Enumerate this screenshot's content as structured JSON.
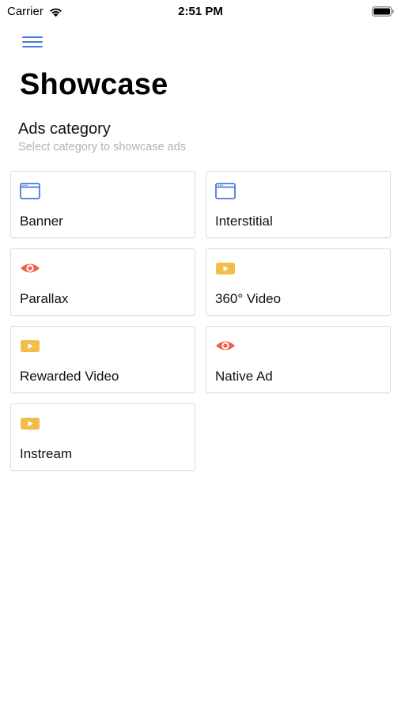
{
  "status_bar": {
    "carrier": "Carrier",
    "time": "2:51 PM"
  },
  "header": {
    "title": "Showcase",
    "menu_icon": "hamburger-menu-icon"
  },
  "section": {
    "title": "Ads category",
    "subtitle": "Select category to showcase ads"
  },
  "categories": [
    {
      "label": "Banner",
      "icon": "browser-window-icon"
    },
    {
      "label": "Interstitial",
      "icon": "browser-window-icon"
    },
    {
      "label": "Parallax",
      "icon": "eye-icon"
    },
    {
      "label": "360° Video",
      "icon": "video-play-icon"
    },
    {
      "label": "Rewarded Video",
      "icon": "video-play-icon"
    },
    {
      "label": "Native Ad",
      "icon": "eye-icon"
    },
    {
      "label": "Instream",
      "icon": "video-play-icon"
    }
  ],
  "colors": {
    "accent_blue": "#4a7ad9",
    "eye_red": "#ef5f4b",
    "video_yellow": "#f2bd4b",
    "subtitle_gray": "#b3b3b3",
    "card_border": "#dcdcdc"
  }
}
